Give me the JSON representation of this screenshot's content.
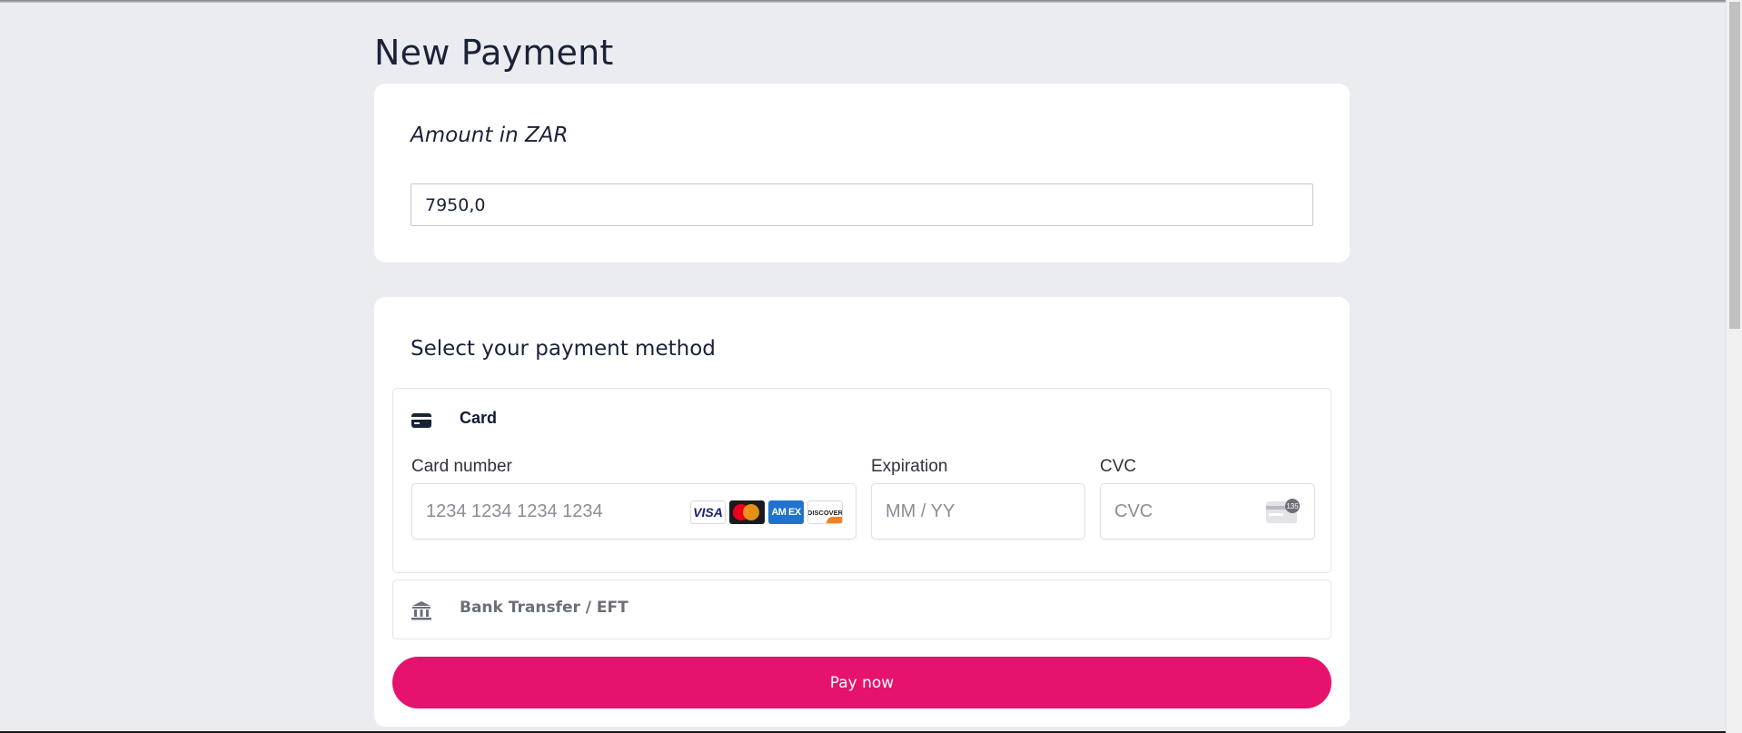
{
  "page": {
    "title": "New Payment"
  },
  "amount": {
    "label": "Amount in ZAR",
    "value": "7950,0"
  },
  "payment": {
    "heading": "Select your payment method",
    "card": {
      "label": "Card",
      "icon": "credit-card-icon",
      "card_number_label": "Card number",
      "card_number_placeholder": "1234 1234 1234 1234",
      "expiration_label": "Expiration",
      "expiration_placeholder": "MM / YY",
      "cvc_label": "CVC",
      "cvc_placeholder": "CVC",
      "brands": [
        "VISA",
        "Mastercard",
        "AMEX",
        "DISCOVER"
      ],
      "amex_text": "AM EX",
      "discover_text": "DISCOVER",
      "cvc_hint": "135"
    },
    "bank": {
      "label": "Bank Transfer / EFT",
      "icon": "bank-icon"
    },
    "pay_label": "Pay now"
  },
  "colors": {
    "background": "#ebecf0",
    "accent": "#e5136e",
    "text": "#1a2238"
  }
}
